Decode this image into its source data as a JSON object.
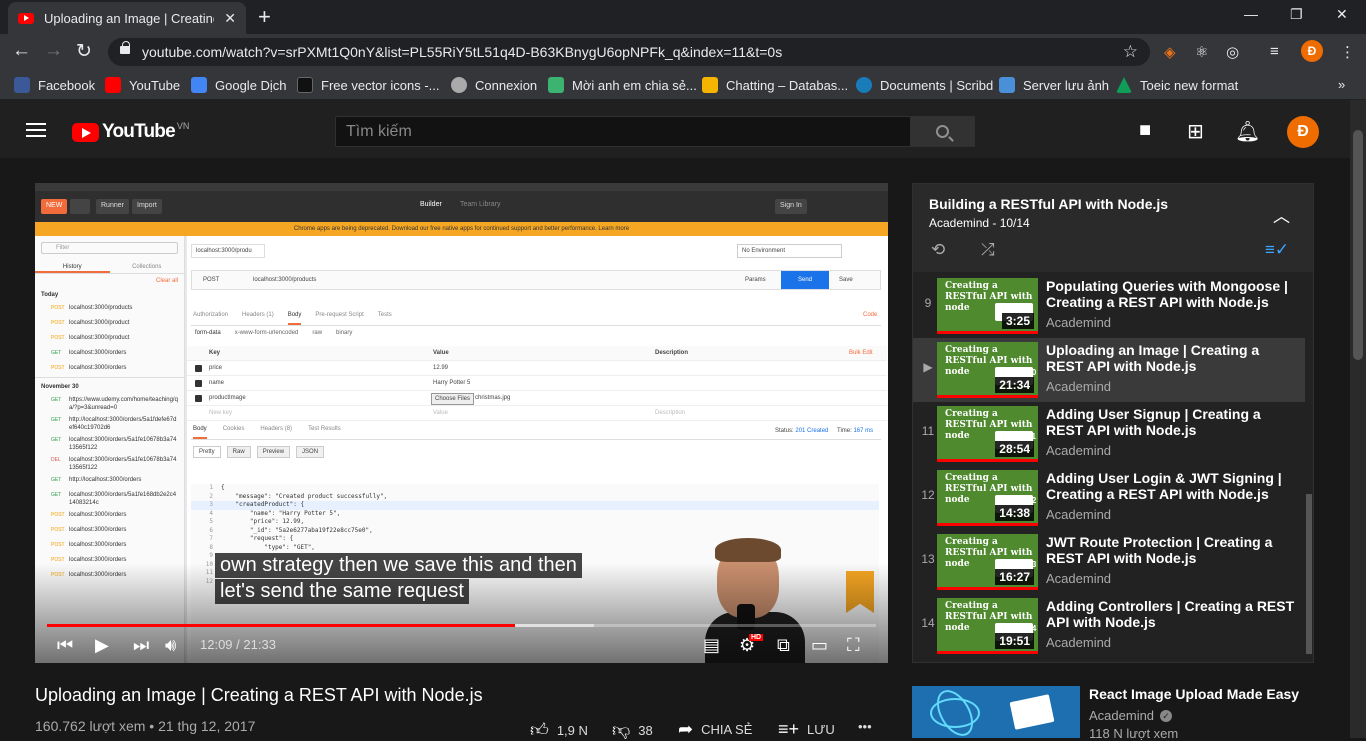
{
  "browser": {
    "tab_title": "Uploading an Image | Creating a",
    "new_tab": "+",
    "url": "youtube.com/watch?v=srPXMt1Q0nY&list=PL55RiY5tL51q4D-B63KBnygU6opNPFk_q&index=11&t=0s",
    "profile_initial": "Đ",
    "bookmarks": [
      "Facebook",
      "YouTube",
      "Google Dịch",
      "Free vector icons -...",
      "Connexion",
      "Mời anh em chia sẻ...",
      "Chatting – Databas...",
      "Documents | Scribd",
      "Server lưu ảnh",
      "Toeic new format"
    ],
    "bookmark_colors": [
      "#3b5998",
      "#ff0000",
      "#4285f4",
      "#000000",
      "#888888",
      "#3cb371",
      "#f4b400",
      "#1a7bba",
      "#4a90d9",
      "#0f9d58"
    ]
  },
  "youtube": {
    "logo_text": "YouTube",
    "region": "VN",
    "search_placeholder": "Tìm kiếm",
    "avatar_initial": "Đ",
    "accent": "#ff0000"
  },
  "player": {
    "captions": [
      "own strategy then we save this and then",
      "let's send the same request"
    ],
    "time_current": "12:09",
    "time_total": "21:33",
    "played_fraction": 0.564,
    "buffered_fraction": 0.66,
    "hd_badge": "HD",
    "postman": {
      "new": "NEW",
      "runner": "Runner",
      "import": "Import",
      "builder": "Builder",
      "team_library": "Team Library",
      "sign_in": "Sign In",
      "banner": "Chrome apps are being deprecated. Download our free native apps for continued support and better performance. Learn more",
      "filter": "Filter",
      "history": "History",
      "collections": "Collections",
      "clear_all": "Clear all",
      "today": "Today",
      "november": "November 30",
      "history_items": [
        {
          "method": "POST",
          "url": "localhost:3000/products"
        },
        {
          "method": "POST",
          "url": "localhost:3000/product"
        },
        {
          "method": "POST",
          "url": "localhost:3000/product"
        },
        {
          "method": "GET",
          "url": "localhost:3000/orders"
        },
        {
          "method": "POST",
          "url": "localhost:3000/orders"
        }
      ],
      "history_items_nov": [
        {
          "method": "GET",
          "url": "https://www.udemy.com/home/teaching/qa/?p=3&unread=0"
        },
        {
          "method": "GET",
          "url": "http://localhost:3000/orders/5a1fdefe67def640c19702d6"
        },
        {
          "method": "GET",
          "url": "localhost:3000/orders/5a1fe10678b3a7413565f122"
        },
        {
          "method": "DEL",
          "url": "localhost:3000/orders/5a1fe10678b3a7413565f122"
        },
        {
          "method": "GET",
          "url": "http://localhost:3000/orders"
        },
        {
          "method": "GET",
          "url": "localhost:3000/orders/5a1fe168db2e2c414083214c"
        },
        {
          "method": "POST",
          "url": "localhost:3000/orders"
        },
        {
          "method": "POST",
          "url": "localhost:3000/orders"
        },
        {
          "method": "POST",
          "url": "localhost:3000/orders"
        },
        {
          "method": "POST",
          "url": "localhost:3000/orders"
        },
        {
          "method": "POST",
          "url": "localhost:3000/orders"
        }
      ],
      "req_tab": "localhost:3000/produ",
      "environment": "No Environment",
      "method": "POST",
      "req_url": "localhost:3000/products",
      "params": "Params",
      "send": "Send",
      "save": "Save",
      "key_placeholder": "New key",
      "value_placeholder": "Value",
      "description_placeholder": "Description",
      "subtabs": [
        "Authorization",
        "Headers (1)",
        "Body",
        "Pre-request Script",
        "Tests"
      ],
      "code": "Code",
      "body_types": [
        "form-data",
        "x-www-form-urlencoded",
        "raw",
        "binary"
      ],
      "col_key": "Key",
      "col_value": "Value",
      "col_desc": "Description",
      "bulk_edit": "Bulk Edit",
      "fields": [
        {
          "key": "price",
          "value": "12.99"
        },
        {
          "key": "name",
          "value": "Harry Potter 5"
        },
        {
          "key": "productImage",
          "value": "christmas.jpg"
        }
      ],
      "choose_files": "Choose Files",
      "resp_tabs": [
        "Body",
        "Cookies",
        "Headers (8)",
        "Test Results"
      ],
      "status_label": "Status:",
      "status": "201 Created",
      "time_label": "Time:",
      "time": "167 ms",
      "view_modes": [
        "Pretty",
        "Raw",
        "Preview",
        "JSON"
      ],
      "code_lines": [
        "{",
        "    \"message\": \"Created product successfully\",",
        "    \"createdProduct\": {",
        "        \"name\": \"Harry Potter 5\",",
        "        \"price\": 12.99,",
        "        \"_id\": \"5a2e6277aba19f22e8cc75e0\",",
        "        \"request\": {",
        "            \"type\": \"GET\",",
        "",
        "",
        "",
        ""
      ]
    }
  },
  "video": {
    "title": "Uploading an Image | Creating a REST API with Node.js",
    "meta": "160.762 lượt xem • 21 thg 12, 2017",
    "likes": "1,9 N",
    "dislikes": "38",
    "share": "CHIA SẺ",
    "save": "LƯU",
    "more": "•••"
  },
  "playlist": {
    "title": "Building a RESTful API with Node.js",
    "subtitle": "Academind - 10/14",
    "items": [
      {
        "index": "9",
        "title": "Populating Queries with Mongoose | Creating a REST API with Node.js",
        "channel": "Academind",
        "duration": "3:25",
        "badge": "#9"
      },
      {
        "index": "▶",
        "title": "Uploading an Image | Creating a REST API with Node.js",
        "channel": "Academind",
        "duration": "21:34",
        "badge": "#10"
      },
      {
        "index": "11",
        "title": "Adding User Signup | Creating a REST API with Node.js",
        "channel": "Academind",
        "duration": "28:54",
        "badge": "#11"
      },
      {
        "index": "12",
        "title": "Adding User Login & JWT Signing | Creating a REST API with Node.js",
        "channel": "Academind",
        "duration": "14:38",
        "badge": "#12"
      },
      {
        "index": "13",
        "title": "JWT Route Protection | Creating a REST API with Node.js",
        "channel": "Academind",
        "duration": "16:27",
        "badge": "#13"
      },
      {
        "index": "14",
        "title": "Adding Controllers | Creating a REST API with Node.js",
        "channel": "Academind",
        "duration": "19:51",
        "badge": "#14"
      }
    ],
    "thumb_text": "Creating a RESTful API with node"
  },
  "recommended": {
    "title": "React Image Upload Made Easy",
    "channel": "Academind",
    "views": "118 N lượt xem"
  }
}
